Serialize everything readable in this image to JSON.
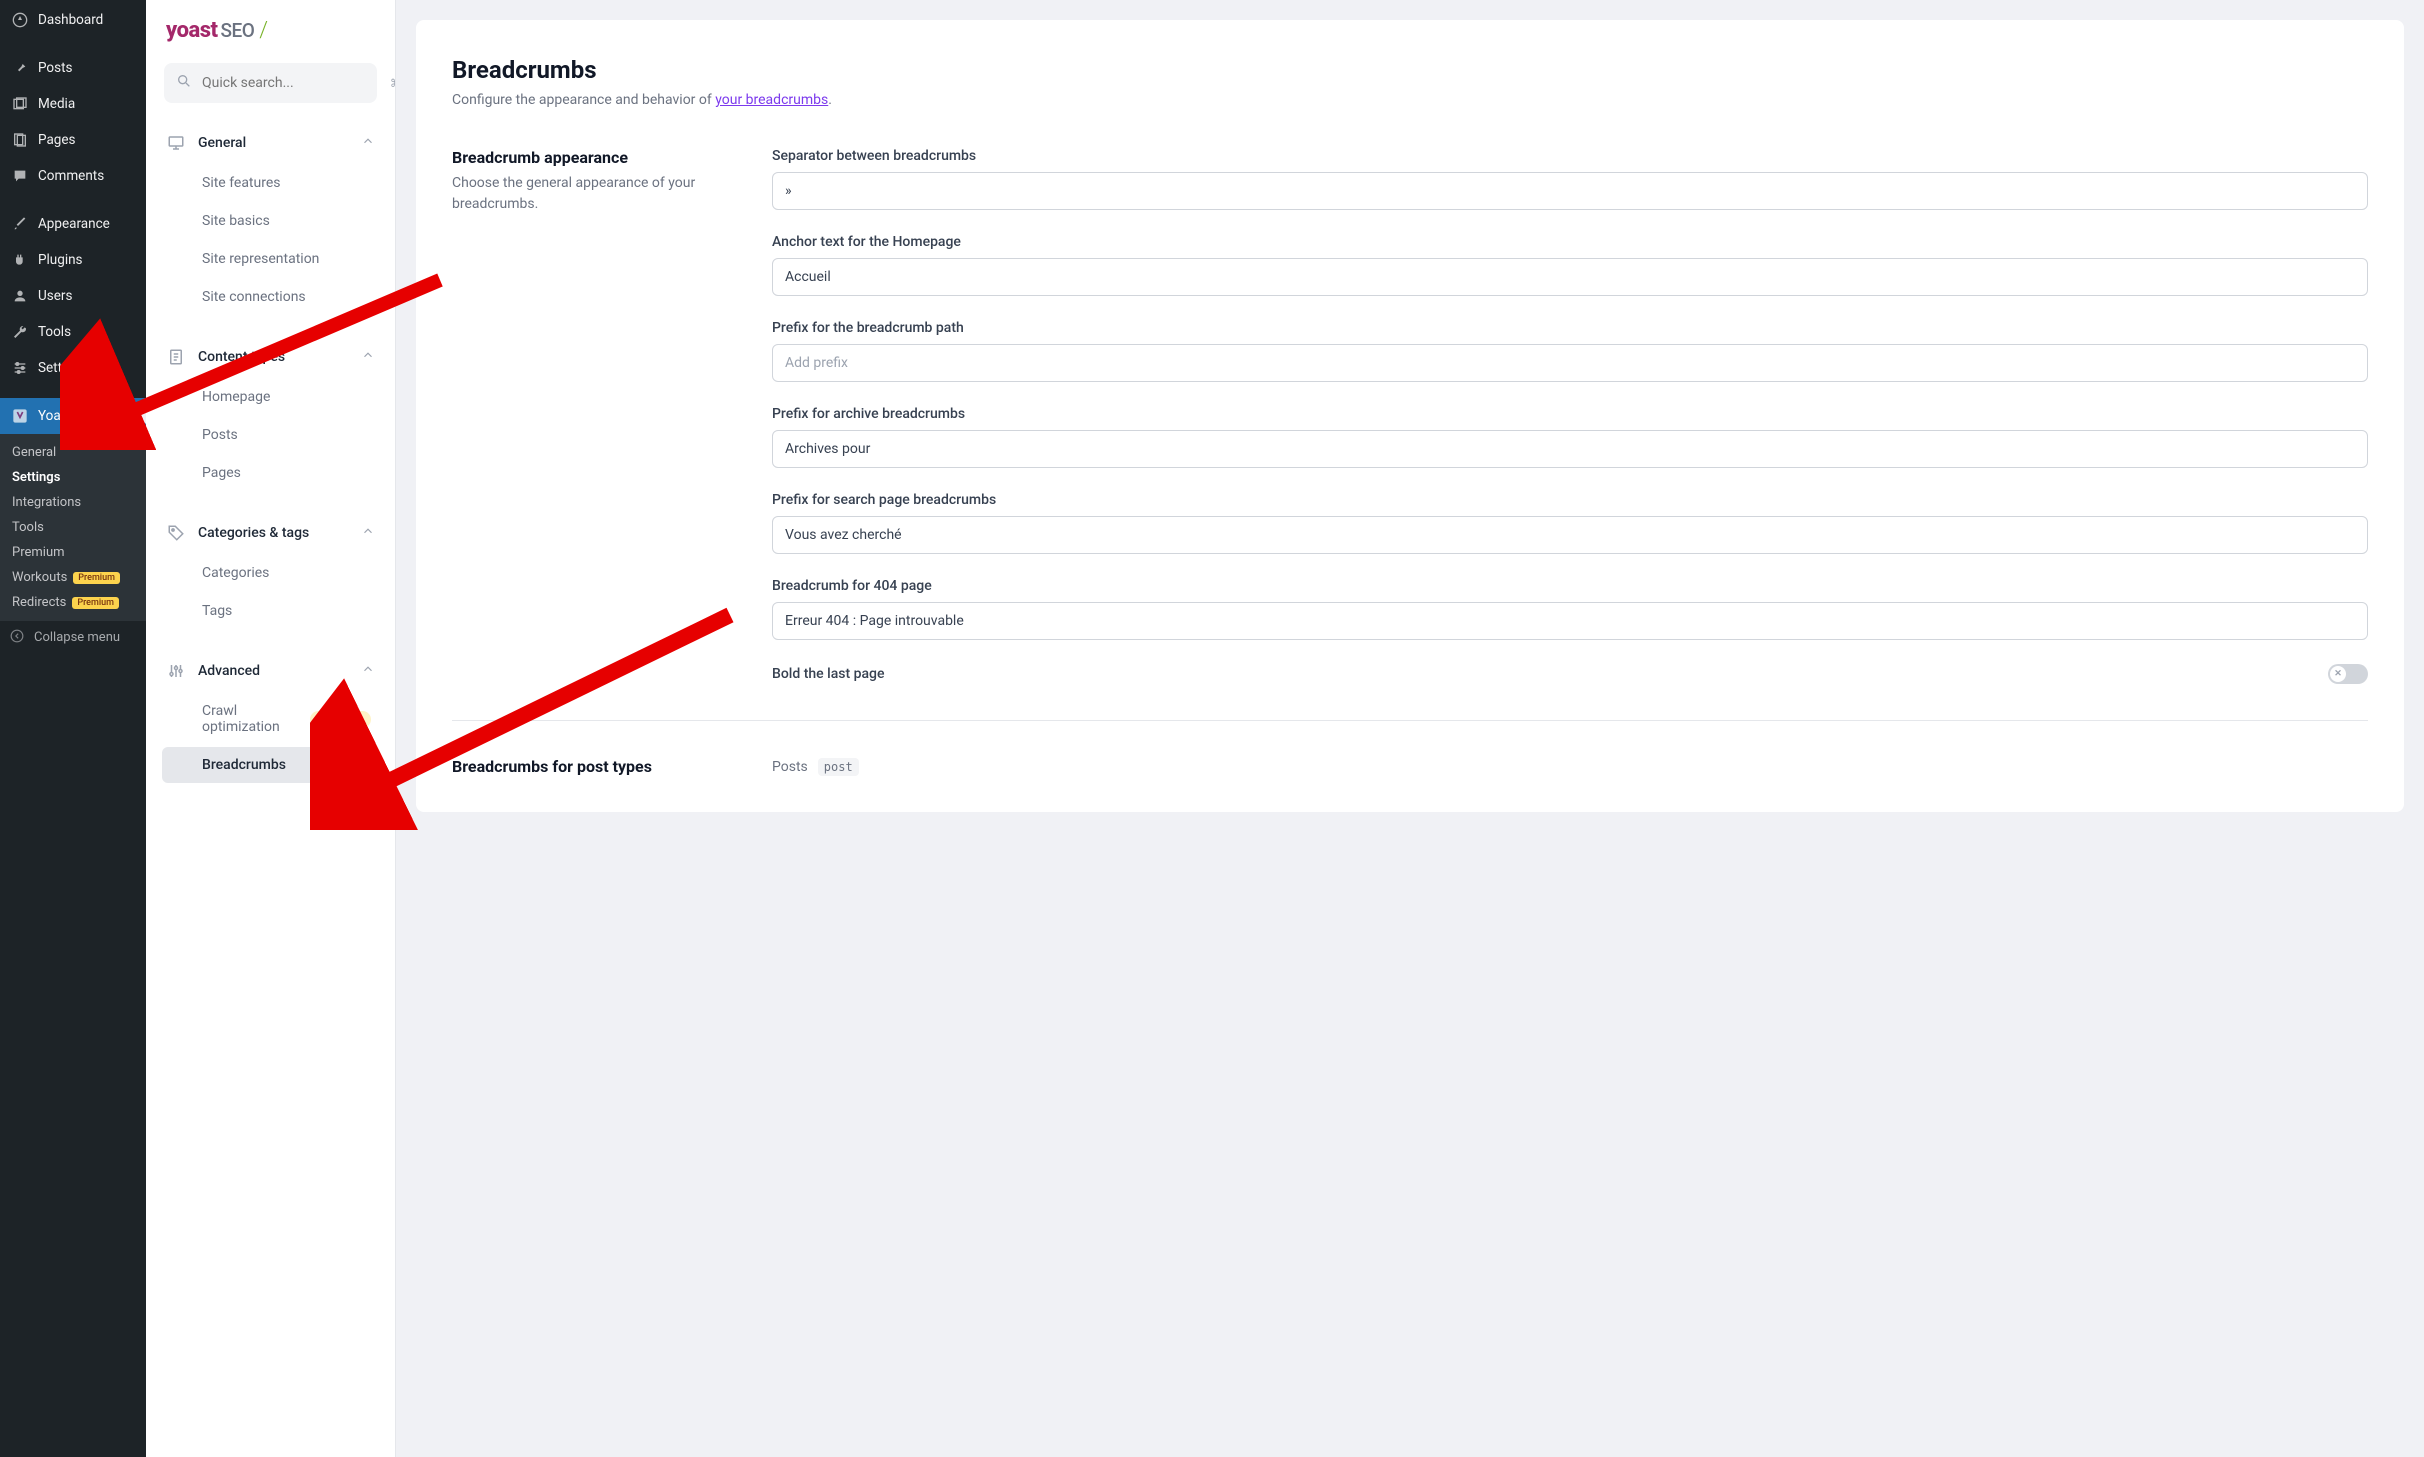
{
  "wp_sidebar": {
    "items": [
      {
        "label": "Dashboard",
        "icon": "dashboard"
      },
      {
        "label": "Posts",
        "icon": "pin"
      },
      {
        "label": "Media",
        "icon": "media"
      },
      {
        "label": "Pages",
        "icon": "page"
      },
      {
        "label": "Comments",
        "icon": "comment"
      }
    ],
    "items2": [
      {
        "label": "Appearance",
        "icon": "brush"
      },
      {
        "label": "Plugins",
        "icon": "plug"
      },
      {
        "label": "Users",
        "icon": "user"
      },
      {
        "label": "Tools",
        "icon": "wrench"
      },
      {
        "label": "Settings",
        "icon": "sliders"
      }
    ],
    "yoast_label": "Yoast SEO",
    "yoast_sub": [
      {
        "label": "General",
        "active": false,
        "premium": false
      },
      {
        "label": "Settings",
        "active": true,
        "premium": false
      },
      {
        "label": "Integrations",
        "active": false,
        "premium": false
      },
      {
        "label": "Tools",
        "active": false,
        "premium": false
      },
      {
        "label": "Premium",
        "active": false,
        "premium": false
      },
      {
        "label": "Workouts",
        "active": false,
        "premium": true
      },
      {
        "label": "Redirects",
        "active": false,
        "premium": true
      }
    ],
    "collapse_label": "Collapse menu"
  },
  "yoast_nav": {
    "logo_main": "yoast",
    "logo_seo": "SEO",
    "search_placeholder": "Quick search...",
    "search_kbd": "⌘K",
    "groups": [
      {
        "label": "General",
        "items": [
          "Site features",
          "Site basics",
          "Site representation",
          "Site connections"
        ]
      },
      {
        "label": "Content types",
        "items": [
          "Homepage",
          "Posts",
          "Pages"
        ]
      },
      {
        "label": "Categories & tags",
        "items": [
          "Categories",
          "Tags"
        ]
      },
      {
        "label": "Advanced",
        "items_adv": [
          {
            "label": "Crawl optimization",
            "premium": true,
            "active": false
          },
          {
            "label": "Breadcrumbs",
            "premium": false,
            "active": true
          }
        ]
      }
    ]
  },
  "main": {
    "title": "Breadcrumbs",
    "desc_prefix": "Configure the appearance and behavior of ",
    "desc_link": "your breadcrumbs",
    "section1": {
      "heading": "Breadcrumb appearance",
      "desc": "Choose the general appearance of your breadcrumbs.",
      "fields": {
        "separator_label": "Separator between breadcrumbs",
        "separator_value": "»",
        "anchor_label": "Anchor text for the Homepage",
        "anchor_value": "Accueil",
        "prefix_path_label": "Prefix for the breadcrumb path",
        "prefix_path_placeholder": "Add prefix",
        "prefix_path_value": "",
        "prefix_archive_label": "Prefix for archive breadcrumbs",
        "prefix_archive_value": "Archives pour",
        "prefix_search_label": "Prefix for search page breadcrumbs",
        "prefix_search_value": "Vous avez cherché",
        "b404_label": "Breadcrumb for 404 page",
        "b404_value": "Erreur 404 : Page introuvable",
        "bold_label": "Bold the last page"
      }
    },
    "section2": {
      "heading": "Breadcrumbs for post types",
      "post_label": "Posts",
      "post_code": "post"
    }
  }
}
